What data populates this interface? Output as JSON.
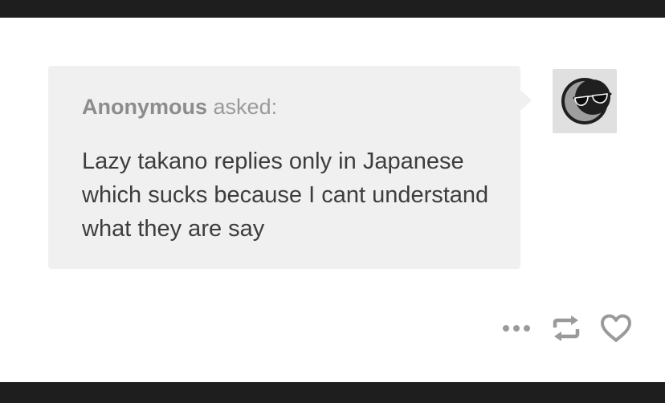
{
  "ask": {
    "asker_name": "Anonymous",
    "asked_label": "asked:",
    "question": "Lazy takano replies only in Japanese which sucks because I cant understand what they are say"
  },
  "avatar": {
    "icon": "moon-sunglasses-icon"
  },
  "actions": {
    "more_icon": "more-dots-icon",
    "reblog_icon": "reblog-icon",
    "like_icon": "heart-icon"
  },
  "colors": {
    "bubble_bg": "#f0f0f0",
    "page_bg": "#ffffff",
    "frame_bg": "#1e1e1e",
    "icon_gray": "#9a9a9a",
    "text_dark": "#3d3d3d"
  }
}
